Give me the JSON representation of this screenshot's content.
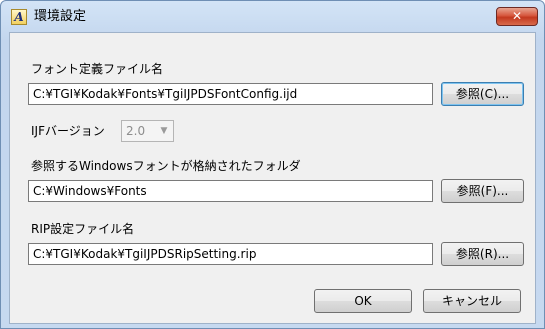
{
  "window": {
    "title": "環境設定",
    "app_icon_glyph": "A",
    "close_glyph": "✕"
  },
  "font_def": {
    "label": "フォント定義ファイル名",
    "path": "C:¥TGI¥Kodak¥Fonts¥TgiIJPDSFontConfig.ijd",
    "browse_label": "参照(C)..."
  },
  "ijf_version": {
    "label": "IJFバージョン",
    "value": "2.0",
    "arrow_glyph": "▼"
  },
  "windows_fonts": {
    "label": "参照するWindowsフォントが格納されたフォルダ",
    "path": "C:¥Windows¥Fonts",
    "browse_label": "参照(F)..."
  },
  "rip_setting": {
    "label": "RIP設定ファイル名",
    "path": "C:¥TGI¥Kodak¥TgiIJPDSRipSetting.rip",
    "browse_label": "参照(R)..."
  },
  "footer": {
    "ok_label": "OK",
    "cancel_label": "キャンセル"
  },
  "colors": {
    "titlebar": "#c6d9f0",
    "client_bg": "#f0f0f0",
    "close_button": "#c3391f"
  }
}
